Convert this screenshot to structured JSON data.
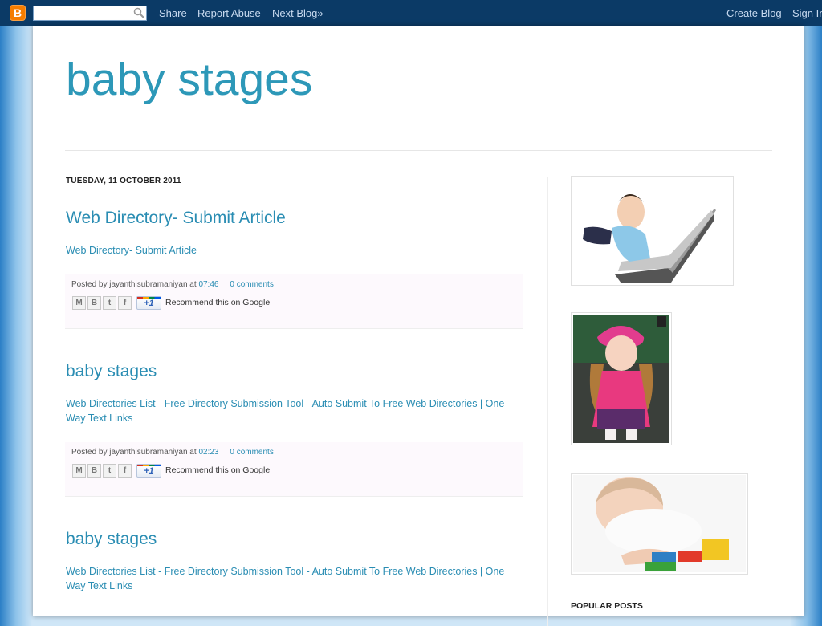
{
  "navbar": {
    "search_placeholder": "",
    "share_label": "Share",
    "report_label": "Report Abuse",
    "next_label": "Next Blog»",
    "create_label": "Create Blog",
    "signin_label": "Sign In",
    "logo_letter": "B"
  },
  "blog": {
    "title": "baby stages"
  },
  "date_header": "TUESDAY, 11 OCTOBER 2011",
  "posts": [
    {
      "title": "Web Directory- Submit Article",
      "body": "Web Directory- Submit Article",
      "posted_by": "Posted by jayanthisubramaniyan at",
      "time": "07:46",
      "comments": "0 comments",
      "recommend": "Recommend this on Google"
    },
    {
      "title": "baby stages",
      "body": "Web Directories List - Free Directory Submission Tool - Auto Submit To Free Web Directories | One Way Text Links",
      "posted_by": "Posted by jayanthisubramaniyan at",
      "time": "02:23",
      "comments": "0 comments",
      "recommend": "Recommend this on Google"
    },
    {
      "title": "baby stages",
      "body": "Web Directories List - Free Directory Submission Tool - Auto Submit To Free Web Directories | One Way Text Links"
    }
  ],
  "share_buttons": {
    "email": "M",
    "blog": "B",
    "twitter": "t",
    "facebook": "f",
    "plusone": "+1"
  },
  "sidebar": {
    "popular_posts_label": "POPULAR POSTS"
  },
  "colors": {
    "accent": "#2a8db3",
    "navbar": "#0b3a66",
    "logo": "#f57d00"
  }
}
